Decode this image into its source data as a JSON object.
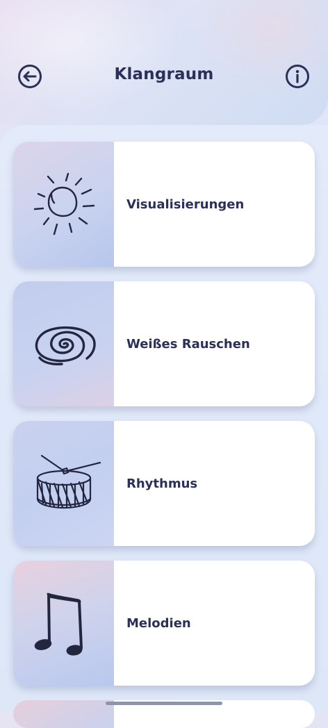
{
  "header": {
    "title": "Klangraum",
    "back_icon": "back-arrow-circle-icon",
    "info_icon": "info-circle-icon"
  },
  "cards": [
    {
      "label": "Visualisierungen",
      "icon": "sun-icon"
    },
    {
      "label": "Weißes Rauschen",
      "icon": "spiral-icon"
    },
    {
      "label": "Rhythmus",
      "icon": "drum-icon"
    },
    {
      "label": "Melodien",
      "icon": "music-note-icon"
    }
  ],
  "colors": {
    "title_text": "#2b3057",
    "card_bg": "#ffffff",
    "accent_thumb": "#c3cff0"
  }
}
